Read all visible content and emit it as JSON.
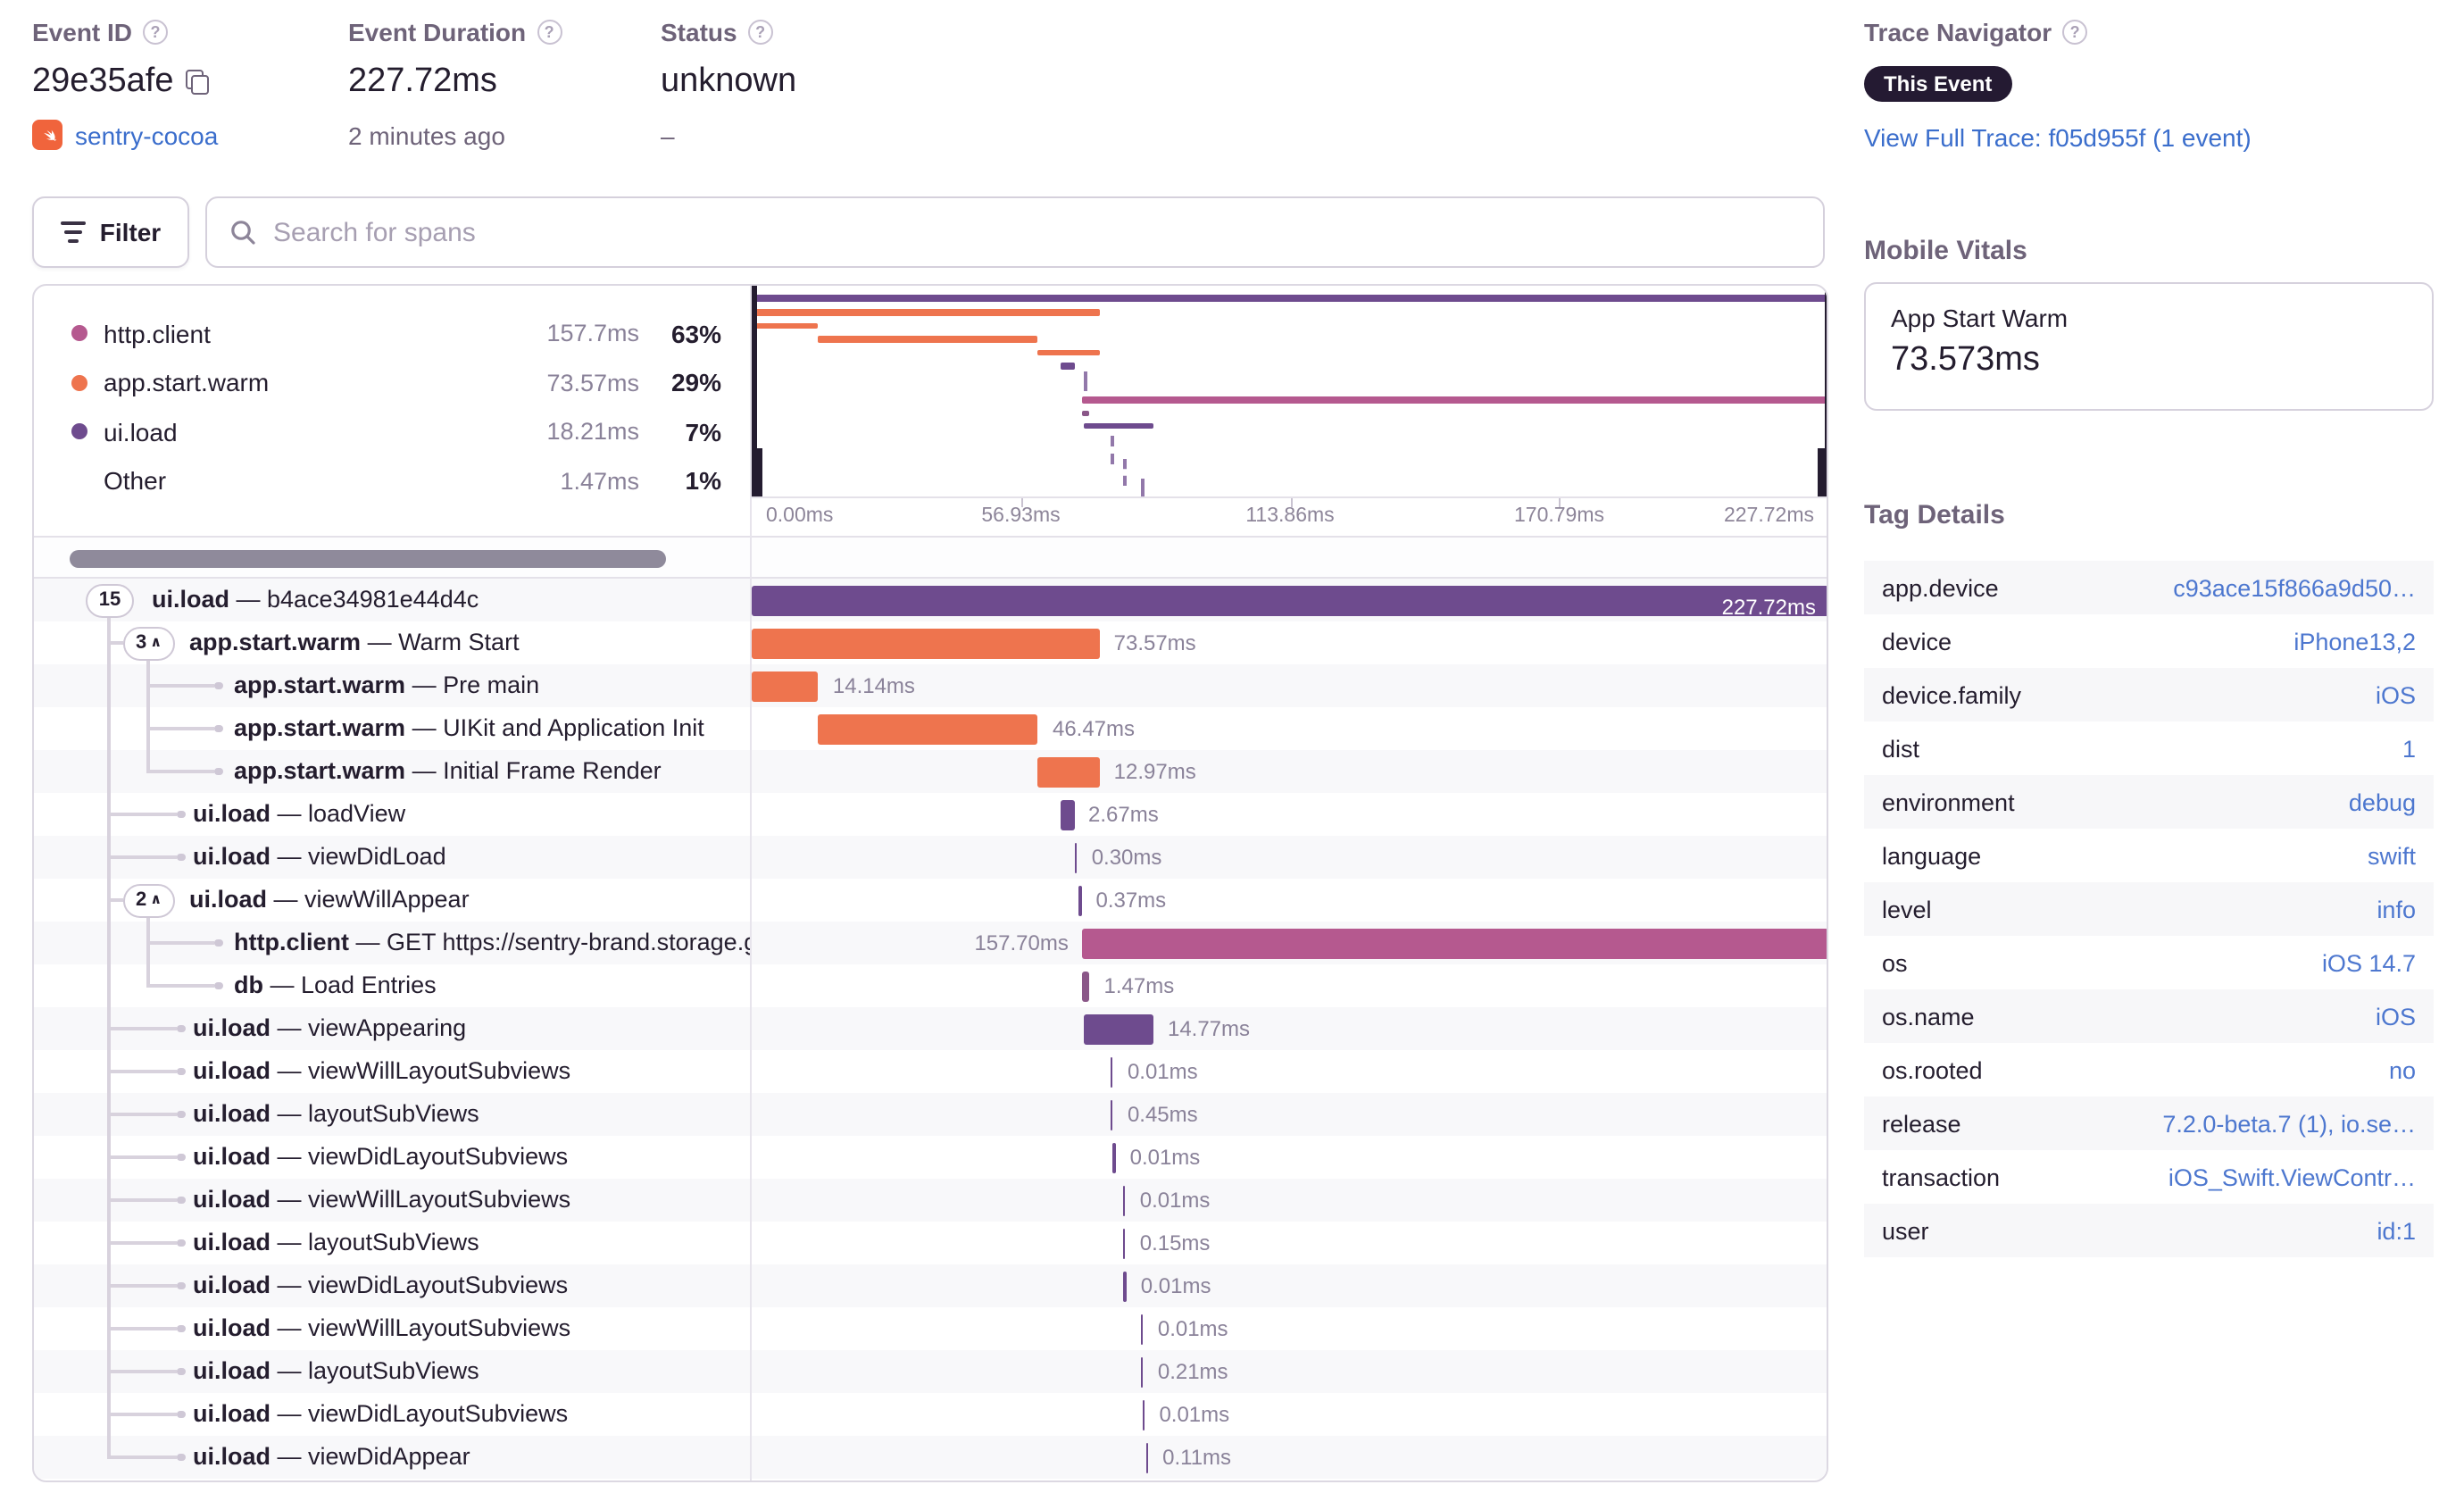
{
  "colors": {
    "uiload": "#6e4b8e",
    "appstart": "#ee744e",
    "http": "#b5598f",
    "db": "#8a5788",
    "link": "#3b6ecc"
  },
  "header": {
    "event_id": {
      "label": "Event ID",
      "value": "29e35afe",
      "project": "sentry-cocoa"
    },
    "duration": {
      "label": "Event Duration",
      "value": "227.72ms",
      "ago": "2 minutes ago"
    },
    "status": {
      "label": "Status",
      "value": "unknown",
      "sub": "–"
    },
    "trace": {
      "label": "Trace Navigator",
      "badge": "This Event",
      "link": "View Full Trace: f05d955f (1 event)"
    }
  },
  "toolbar": {
    "filter_label": "Filter",
    "search_placeholder": "Search for spans"
  },
  "legend": {
    "items": [
      {
        "name": "http.client",
        "ms": "157.7ms",
        "pct": "63%",
        "color": "http"
      },
      {
        "name": "app.start.warm",
        "ms": "73.57ms",
        "pct": "29%",
        "color": "appstart"
      },
      {
        "name": "ui.load",
        "ms": "18.21ms",
        "pct": "7%",
        "color": "uiload"
      },
      {
        "name": "Other",
        "ms": "1.47ms",
        "pct": "1%",
        "color": ""
      }
    ]
  },
  "minimap": {
    "total_ms": 227.72,
    "axis": [
      "0.00ms",
      "56.93ms",
      "113.86ms",
      "170.79ms",
      "227.72ms"
    ]
  },
  "tree": {
    "rows": [
      {
        "op": "ui.load",
        "desc": "b4ace34981e44d4c",
        "pill": "15",
        "chevron": false,
        "level": 0,
        "start": 0,
        "dur": 227.72,
        "dur_label": "227.72ms",
        "color": "uiload",
        "label_mode": "inside"
      },
      {
        "op": "app.start.warm",
        "desc": "Warm Start",
        "pill": "3",
        "chevron": true,
        "level": 1,
        "start": 0,
        "dur": 73.57,
        "dur_label": "73.57ms",
        "color": "appstart",
        "label_mode": "right"
      },
      {
        "op": "app.start.warm",
        "desc": "Pre main",
        "level": 2,
        "start": 0,
        "dur": 14.14,
        "dur_label": "14.14ms",
        "color": "appstart",
        "label_mode": "right"
      },
      {
        "op": "app.start.warm",
        "desc": "UIKit and Application Init",
        "level": 2,
        "start": 14.14,
        "dur": 46.47,
        "dur_label": "46.47ms",
        "color": "appstart",
        "label_mode": "right"
      },
      {
        "op": "app.start.warm",
        "desc": "Initial Frame Render",
        "level": 2,
        "start": 60.61,
        "dur": 12.97,
        "dur_label": "12.97ms",
        "color": "appstart",
        "label_mode": "right"
      },
      {
        "op": "ui.load",
        "desc": "loadView",
        "level": 1,
        "start": 65.5,
        "dur": 2.67,
        "dur_label": "2.67ms",
        "color": "uiload",
        "label_mode": "right"
      },
      {
        "op": "ui.load",
        "desc": "viewDidLoad",
        "level": 1,
        "start": 68.3,
        "dur": 0.3,
        "dur_label": "0.30ms",
        "color": "uiload",
        "label_mode": "right"
      },
      {
        "op": "ui.load",
        "desc": "viewWillAppear",
        "pill": "2",
        "chevron": true,
        "level": 1,
        "start": 69.2,
        "dur": 0.37,
        "dur_label": "0.37ms",
        "color": "uiload",
        "label_mode": "right"
      },
      {
        "op": "http.client",
        "desc": "GET https://sentry-brand.storage.googlea",
        "level": 2,
        "start": 70.02,
        "dur": 157.7,
        "dur_label": "157.70ms",
        "color": "http",
        "label_mode": "left"
      },
      {
        "op": "db",
        "desc": "Load Entries",
        "level": 2,
        "start": 70.0,
        "dur": 1.47,
        "dur_label": "1.47ms",
        "color": "db",
        "label_mode": "right"
      },
      {
        "op": "ui.load",
        "desc": "viewAppearing",
        "level": 1,
        "start": 70.2,
        "dur": 14.77,
        "dur_label": "14.77ms",
        "color": "uiload",
        "label_mode": "right"
      },
      {
        "op": "ui.load",
        "desc": "viewWillLayoutSubviews",
        "level": 1,
        "start": 75.9,
        "dur": 0.01,
        "dur_label": "0.01ms",
        "color": "uiload",
        "label_mode": "right"
      },
      {
        "op": "ui.load",
        "desc": "layoutSubViews",
        "level": 1,
        "start": 75.9,
        "dur": 0.45,
        "dur_label": "0.45ms",
        "color": "uiload",
        "label_mode": "right"
      },
      {
        "op": "ui.load",
        "desc": "viewDidLayoutSubviews",
        "level": 1,
        "start": 76.4,
        "dur": 0.01,
        "dur_label": "0.01ms",
        "color": "uiload",
        "label_mode": "right"
      },
      {
        "op": "ui.load",
        "desc": "viewWillLayoutSubviews",
        "level": 1,
        "start": 78.5,
        "dur": 0.01,
        "dur_label": "0.01ms",
        "color": "uiload",
        "label_mode": "right"
      },
      {
        "op": "ui.load",
        "desc": "layoutSubViews",
        "level": 1,
        "start": 78.5,
        "dur": 0.15,
        "dur_label": "0.15ms",
        "color": "uiload",
        "label_mode": "right"
      },
      {
        "op": "ui.load",
        "desc": "viewDidLayoutSubviews",
        "level": 1,
        "start": 78.7,
        "dur": 0.01,
        "dur_label": "0.01ms",
        "color": "uiload",
        "label_mode": "right"
      },
      {
        "op": "ui.load",
        "desc": "viewWillLayoutSubviews",
        "level": 1,
        "start": 82.3,
        "dur": 0.01,
        "dur_label": "0.01ms",
        "color": "uiload",
        "label_mode": "right"
      },
      {
        "op": "ui.load",
        "desc": "layoutSubViews",
        "level": 1,
        "start": 82.3,
        "dur": 0.21,
        "dur_label": "0.21ms",
        "color": "uiload",
        "label_mode": "right"
      },
      {
        "op": "ui.load",
        "desc": "viewDidLayoutSubviews",
        "level": 1,
        "start": 82.6,
        "dur": 0.01,
        "dur_label": "0.01ms",
        "color": "uiload",
        "label_mode": "right"
      },
      {
        "op": "ui.load",
        "desc": "viewDidAppear",
        "level": 1,
        "start": 83.3,
        "dur": 0.11,
        "dur_label": "0.11ms",
        "color": "uiload",
        "label_mode": "right"
      }
    ]
  },
  "sidebar": {
    "vitals": {
      "heading": "Mobile Vitals",
      "card_title": "App Start Warm",
      "card_value": "73.573ms"
    },
    "tags": {
      "heading": "Tag Details",
      "rows": [
        {
          "key": "app.device",
          "value": "c93ace15f866a9d50…"
        },
        {
          "key": "device",
          "value": "iPhone13,2"
        },
        {
          "key": "device.family",
          "value": "iOS"
        },
        {
          "key": "dist",
          "value": "1"
        },
        {
          "key": "environment",
          "value": "debug"
        },
        {
          "key": "language",
          "value": "swift"
        },
        {
          "key": "level",
          "value": "info"
        },
        {
          "key": "os",
          "value": "iOS 14.7"
        },
        {
          "key": "os.name",
          "value": "iOS"
        },
        {
          "key": "os.rooted",
          "value": "no"
        },
        {
          "key": "release",
          "value": "7.2.0-beta.7 (1), io.se…"
        },
        {
          "key": "transaction",
          "value": "iOS_Swift.ViewContr…"
        },
        {
          "key": "user",
          "value": "id:1"
        }
      ]
    }
  }
}
